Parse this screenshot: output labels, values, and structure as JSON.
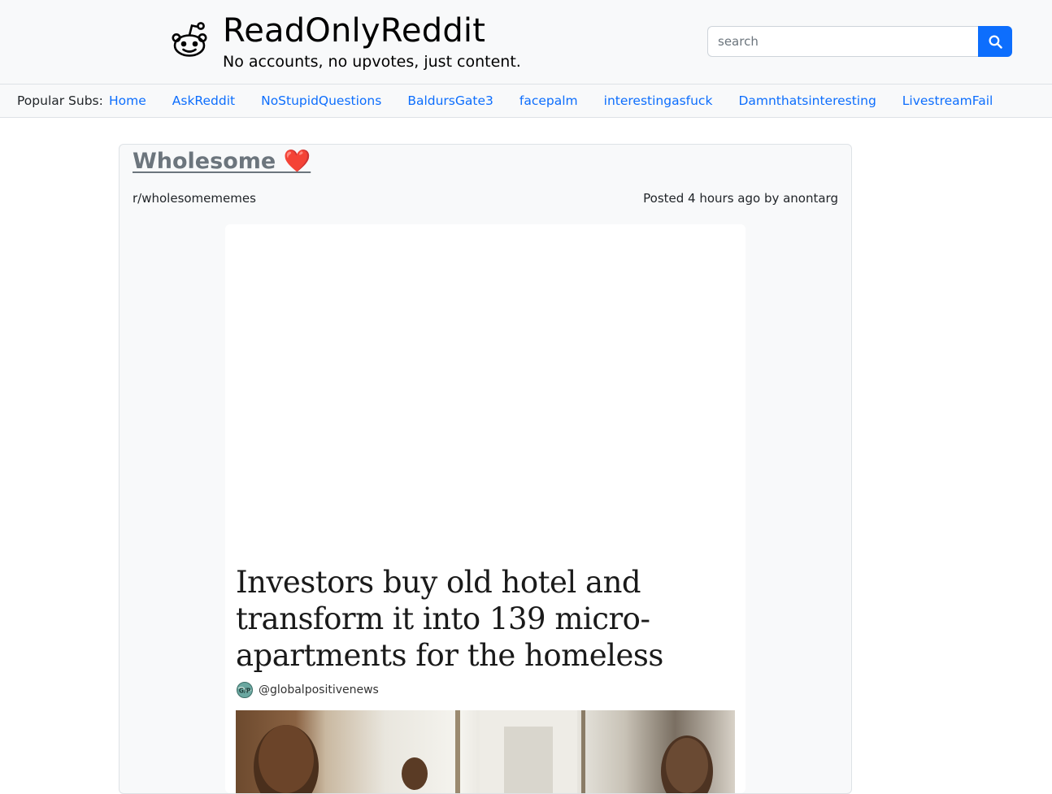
{
  "header": {
    "title": "ReadOnlyReddit",
    "tagline": "No accounts, no upvotes, just content.",
    "logo_icon": "reddit-alien-icon",
    "search": {
      "placeholder": "search",
      "button_icon": "search-icon"
    }
  },
  "subnav": {
    "label": "Popular Subs:",
    "links": [
      "Home",
      "AskReddit",
      "NoStupidQuestions",
      "BaldursGate3",
      "facepalm",
      "interestingasfuck",
      "Damnthatsinteresting",
      "LivestreamFail"
    ]
  },
  "post": {
    "title": "Wholesome ❤️",
    "subreddit": "r/wholesomememes",
    "meta": "Posted 4 hours ago by anontarg",
    "image": {
      "headline": "Investors buy old hotel and transform it into 139 micro-apartments for the homeless",
      "source_badge": "G/P",
      "source_handle": "@globalpositivenews"
    }
  },
  "colors": {
    "accent": "#0d6efd",
    "header_bg": "#f8f9fa",
    "title_muted": "#6c757d"
  }
}
